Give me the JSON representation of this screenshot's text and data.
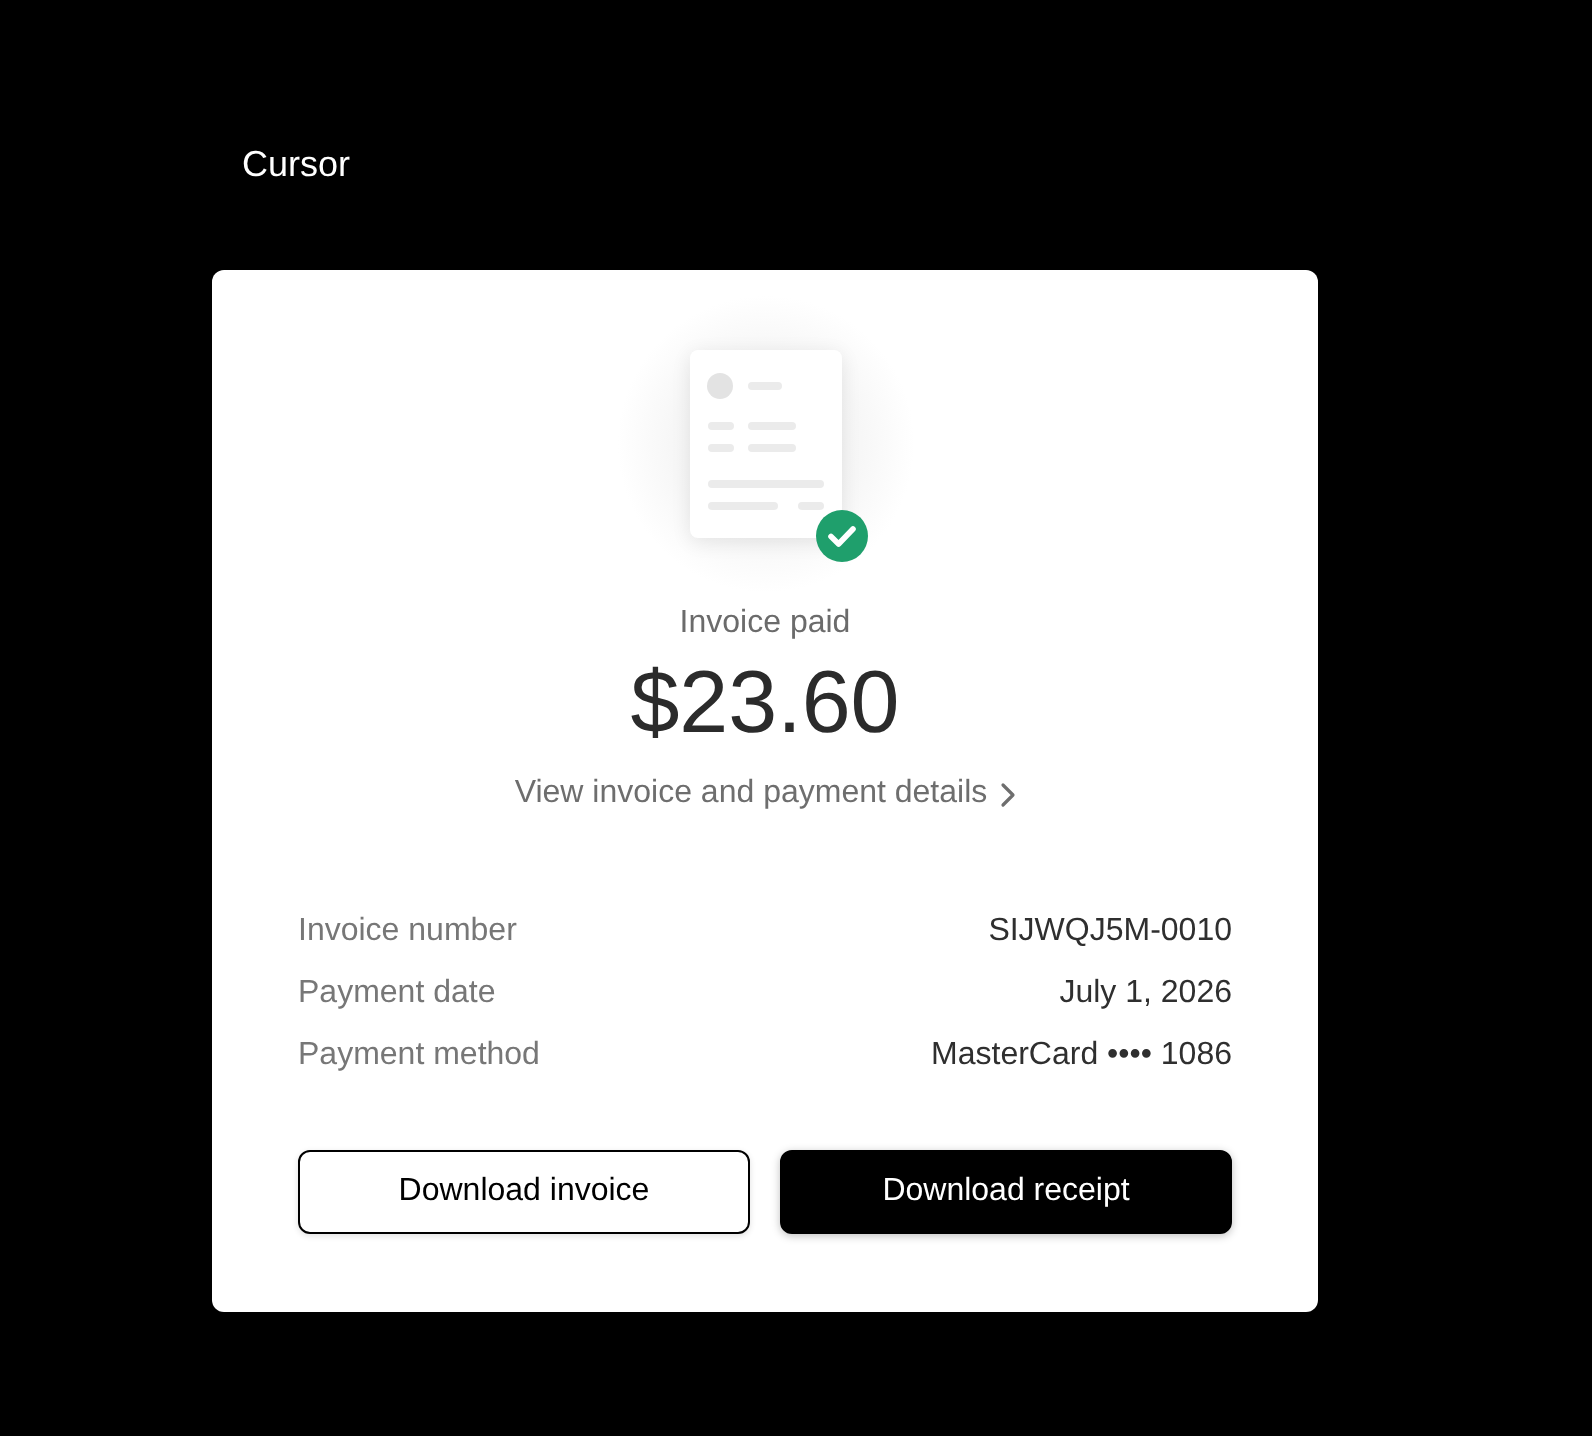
{
  "app": {
    "name": "Cursor"
  },
  "invoice": {
    "paid": true,
    "status": "Invoice paid",
    "amount": "$23.60",
    "details_link": "View invoice and payment details",
    "details": [
      {
        "label": "Invoice number",
        "value": "SIJWQJ5M-0010"
      },
      {
        "label": "Payment date",
        "value": "July 1, 2026"
      },
      {
        "label": "Payment method",
        "value": "MasterCard •••• 1086"
      }
    ],
    "buttons": [
      {
        "label": "Download invoice",
        "kind": "secondary"
      },
      {
        "label": "Download receipt",
        "kind": "primary"
      }
    ]
  }
}
